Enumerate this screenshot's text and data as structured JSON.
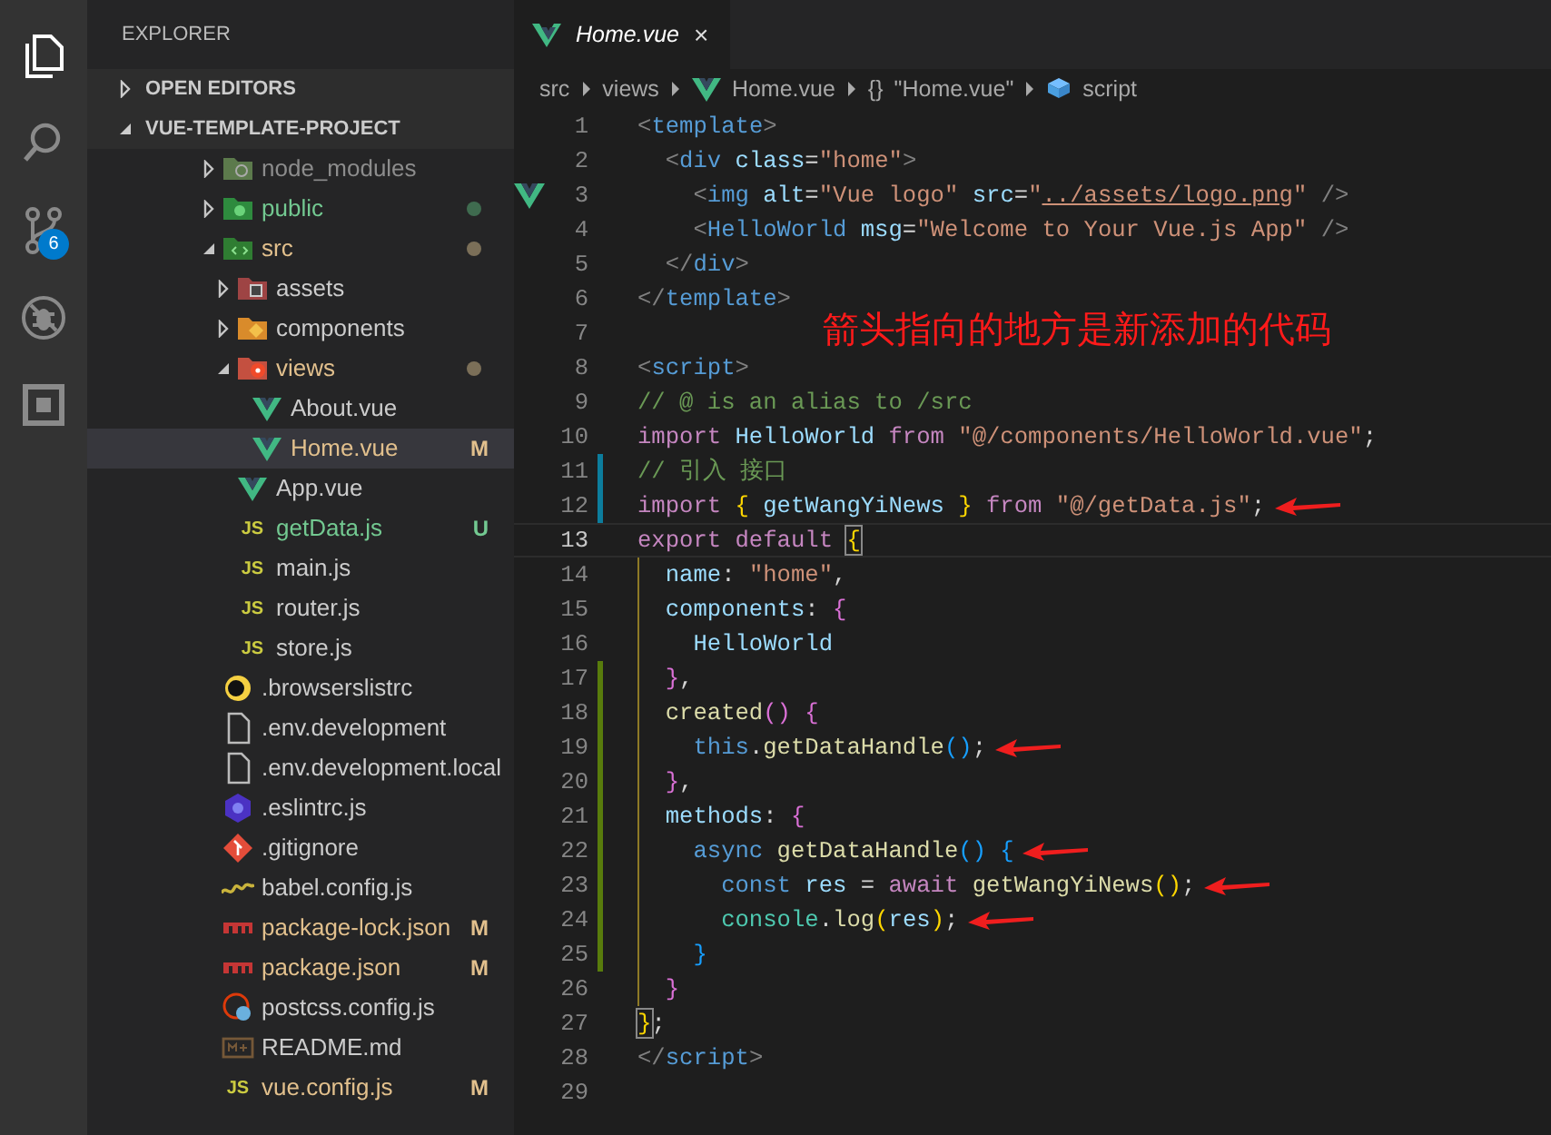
{
  "activity_bar": [
    {
      "kind": "files",
      "selected": true
    },
    {
      "kind": "search",
      "selected": false
    },
    {
      "kind": "source-control",
      "selected": false,
      "badge": "6"
    },
    {
      "kind": "debug",
      "selected": false
    },
    {
      "kind": "extensions",
      "selected": false
    }
  ],
  "sidebar": {
    "title": "EXPLORER",
    "sections": [
      {
        "label": "OPEN EDITORS",
        "expanded": false
      },
      {
        "label": "VUE-TEMPLATE-PROJECT",
        "expanded": true
      }
    ],
    "tree": [
      {
        "label": "node_modules",
        "kind": "node-folder",
        "expanded": false,
        "selected": false,
        "ignored": true
      },
      {
        "label": "public",
        "kind": "public-folder",
        "expanded": false,
        "selected": false,
        "untracked": true,
        "dot": true
      },
      {
        "label": "src",
        "kind": "src-folder",
        "expanded": true,
        "selected": false,
        "modified": true,
        "dot": true,
        "children": [
          {
            "label": "assets",
            "kind": "assets-folder",
            "expanded": false,
            "selected": false
          },
          {
            "label": "components",
            "kind": "components-folder",
            "expanded": false,
            "selected": false
          },
          {
            "label": "views",
            "kind": "views-folder",
            "expanded": true,
            "selected": false,
            "modified": true,
            "dot": true,
            "children": [
              {
                "label": "About.vue",
                "kind": "vue",
                "selected": false
              },
              {
                "label": "Home.vue",
                "kind": "vue",
                "selected": true,
                "modified": true,
                "badge": "M"
              }
            ]
          },
          {
            "label": "App.vue",
            "kind": "vue",
            "selected": false
          },
          {
            "label": "getData.js",
            "kind": "js",
            "icon_text": "JS",
            "selected": false,
            "untracked": true,
            "badge": "U"
          },
          {
            "label": "main.js",
            "kind": "js",
            "icon_text": "JS",
            "selected": false
          },
          {
            "label": "router.js",
            "kind": "js",
            "icon_text": "JS",
            "selected": false
          },
          {
            "label": "store.js",
            "kind": "js",
            "icon_text": "JS",
            "selected": false
          }
        ]
      },
      {
        "label": ".browserslistrc",
        "kind": "browserslist",
        "selected": false
      },
      {
        "label": ".env.development",
        "kind": "file",
        "selected": false
      },
      {
        "label": ".env.development.local",
        "kind": "file",
        "selected": false
      },
      {
        "label": ".eslintrc.js",
        "kind": "eslint",
        "selected": false
      },
      {
        "label": ".gitignore",
        "kind": "git",
        "selected": false
      },
      {
        "label": "babel.config.js",
        "kind": "babel",
        "selected": false
      },
      {
        "label": "package-lock.json",
        "kind": "npm",
        "selected": false,
        "modified": true,
        "badge": "M"
      },
      {
        "label": "package.json",
        "kind": "npm",
        "selected": false,
        "modified": true,
        "badge": "M"
      },
      {
        "label": "postcss.config.js",
        "kind": "postcss",
        "selected": false
      },
      {
        "label": "README.md",
        "kind": "markdown",
        "selected": false
      },
      {
        "label": "vue.config.js",
        "kind": "js",
        "icon_text": "JS",
        "selected": false,
        "modified": true,
        "badge": "M"
      }
    ]
  },
  "tabs": [
    {
      "label": "Home.vue",
      "close": "×",
      "preview": true,
      "selected": true
    }
  ],
  "breadcrumbs": [
    {
      "label": "src",
      "kind": "folder"
    },
    {
      "label": "views",
      "kind": "folder"
    },
    {
      "label": "Home.vue",
      "kind": "vue"
    },
    {
      "label": "\"Home.vue\"",
      "kind": "object",
      "icon_text": "{}"
    },
    {
      "label": "script",
      "kind": "module"
    }
  ],
  "annotation": "箭头指向的地方是新添加的代码",
  "lines": [
    {
      "number": "1",
      "tokens": [
        {
          "text": "<",
          "kind": "punct"
        },
        {
          "text": "template",
          "kind": "tag"
        },
        {
          "text": ">",
          "kind": "punct"
        }
      ]
    },
    {
      "number": "2",
      "tokens": [
        {
          "text": "  <",
          "kind": "punct"
        },
        {
          "text": "div",
          "kind": "tag"
        },
        {
          "text": " class",
          "kind": "attr"
        },
        {
          "text": "=",
          "kind": "plain"
        },
        {
          "text": "\"home\"",
          "kind": "string"
        },
        {
          "text": ">",
          "kind": "punct"
        }
      ]
    },
    {
      "number": "3",
      "glyph": true,
      "tokens": [
        {
          "text": "    <",
          "kind": "punct"
        },
        {
          "text": "img",
          "kind": "tag"
        },
        {
          "text": " alt",
          "kind": "attr"
        },
        {
          "text": "=",
          "kind": "plain"
        },
        {
          "text": "\"Vue logo\"",
          "kind": "string"
        },
        {
          "text": " src",
          "kind": "attr"
        },
        {
          "text": "=",
          "kind": "plain"
        },
        {
          "text": "\"",
          "kind": "string"
        },
        {
          "text": "../assets/logo.png",
          "kind": "link"
        },
        {
          "text": "\"",
          "kind": "string"
        },
        {
          "text": " />",
          "kind": "punct"
        }
      ]
    },
    {
      "number": "4",
      "tokens": [
        {
          "text": "    <",
          "kind": "punct"
        },
        {
          "text": "HelloWorld",
          "kind": "tag"
        },
        {
          "text": " msg",
          "kind": "attr"
        },
        {
          "text": "=",
          "kind": "plain"
        },
        {
          "text": "\"Welcome to Your Vue.js App\"",
          "kind": "string"
        },
        {
          "text": " />",
          "kind": "punct"
        }
      ]
    },
    {
      "number": "5",
      "tokens": [
        {
          "text": "  </",
          "kind": "punct"
        },
        {
          "text": "div",
          "kind": "tag"
        },
        {
          "text": ">",
          "kind": "punct"
        }
      ]
    },
    {
      "number": "6",
      "tokens": [
        {
          "text": "</",
          "kind": "punct"
        },
        {
          "text": "template",
          "kind": "tag"
        },
        {
          "text": ">",
          "kind": "punct"
        }
      ]
    },
    {
      "number": "7"
    },
    {
      "number": "8",
      "tokens": [
        {
          "text": "<",
          "kind": "punct"
        },
        {
          "text": "script",
          "kind": "tag"
        },
        {
          "text": ">",
          "kind": "punct"
        }
      ]
    },
    {
      "number": "9",
      "tokens": [
        {
          "text": "// @ is an alias to /src",
          "kind": "comment"
        }
      ]
    },
    {
      "number": "10",
      "tokens": [
        {
          "text": "import",
          "kind": "keyword"
        },
        {
          "text": " HelloWorld",
          "kind": "variable"
        },
        {
          "text": " from",
          "kind": "keyword"
        },
        {
          "text": " \"@/components/HelloWorld.vue\"",
          "kind": "string"
        },
        {
          "text": ";",
          "kind": "plain"
        }
      ]
    },
    {
      "number": "11",
      "modified": true,
      "tokens": [
        {
          "text": "// 引入 接口",
          "kind": "comment"
        }
      ]
    },
    {
      "number": "12",
      "modified": true,
      "arrow": true,
      "tokens": [
        {
          "text": "import",
          "kind": "keyword"
        },
        {
          "text": " {",
          "kind": "brace1"
        },
        {
          "text": " getWangYiNews",
          "kind": "variable"
        },
        {
          "text": " }",
          "kind": "brace1"
        },
        {
          "text": " from",
          "kind": "keyword"
        },
        {
          "text": " \"@/getData.js\"",
          "kind": "string"
        },
        {
          "text": ";",
          "kind": "plain"
        }
      ]
    },
    {
      "number": "13",
      "current": true,
      "tokens": [
        {
          "text": "export default ",
          "kind": "keyword"
        },
        {
          "text": "{",
          "kind": "match"
        }
      ]
    },
    {
      "number": "14",
      "scope_guide": true,
      "tokens": [
        {
          "text": "  name",
          "kind": "variable"
        },
        {
          "text": ": ",
          "kind": "plain"
        },
        {
          "text": "\"home\"",
          "kind": "string"
        },
        {
          "text": ",",
          "kind": "plain"
        }
      ]
    },
    {
      "number": "15",
      "scope_guide": true,
      "tokens": [
        {
          "text": "  components",
          "kind": "variable"
        },
        {
          "text": ": ",
          "kind": "plain"
        },
        {
          "text": "{",
          "kind": "brace2"
        }
      ]
    },
    {
      "number": "16",
      "scope_guide": true,
      "tokens": [
        {
          "text": "    HelloWorld",
          "kind": "variable"
        }
      ]
    },
    {
      "number": "17",
      "scope_guide": true,
      "added": true,
      "tokens": [
        {
          "text": "  }",
          "kind": "brace2"
        },
        {
          "text": ",",
          "kind": "plain"
        }
      ]
    },
    {
      "number": "18",
      "scope_guide": true,
      "added": true,
      "tokens": [
        {
          "text": "  created",
          "kind": "function"
        },
        {
          "text": "()",
          "kind": "brace2"
        },
        {
          "text": " {",
          "kind": "brace2"
        }
      ]
    },
    {
      "number": "19",
      "scope_guide": true,
      "added": true,
      "arrow": true,
      "tokens": [
        {
          "text": "    this",
          "kind": "storage"
        },
        {
          "text": ".",
          "kind": "plain"
        },
        {
          "text": "getDataHandle",
          "kind": "function"
        },
        {
          "text": "()",
          "kind": "brace3"
        },
        {
          "text": ";",
          "kind": "plain"
        }
      ]
    },
    {
      "number": "20",
      "scope_guide": true,
      "added": true,
      "tokens": [
        {
          "text": "  }",
          "kind": "brace2"
        },
        {
          "text": ",",
          "kind": "plain"
        }
      ]
    },
    {
      "number": "21",
      "scope_guide": true,
      "added": true,
      "tokens": [
        {
          "text": "  methods",
          "kind": "variable"
        },
        {
          "text": ": ",
          "kind": "plain"
        },
        {
          "text": "{",
          "kind": "brace2"
        }
      ]
    },
    {
      "number": "22",
      "scope_guide": true,
      "added": true,
      "arrow": true,
      "tokens": [
        {
          "text": "    async",
          "kind": "storage"
        },
        {
          "text": " getDataHandle",
          "kind": "function"
        },
        {
          "text": "()",
          "kind": "brace3"
        },
        {
          "text": " {",
          "kind": "brace3"
        }
      ]
    },
    {
      "number": "23",
      "scope_guide": true,
      "added": true,
      "arrow": true,
      "tokens": [
        {
          "text": "      const",
          "kind": "storage"
        },
        {
          "text": " res",
          "kind": "variable"
        },
        {
          "text": " = ",
          "kind": "plain"
        },
        {
          "text": "await",
          "kind": "keyword"
        },
        {
          "text": " getWangYiNews",
          "kind": "function"
        },
        {
          "text": "()",
          "kind": "brace1"
        },
        {
          "text": ";",
          "kind": "plain"
        }
      ]
    },
    {
      "number": "24",
      "scope_guide": true,
      "added": true,
      "arrow": true,
      "tokens": [
        {
          "text": "      console",
          "kind": "class"
        },
        {
          "text": ".",
          "kind": "plain"
        },
        {
          "text": "log",
          "kind": "function"
        },
        {
          "text": "(",
          "kind": "brace1"
        },
        {
          "text": "res",
          "kind": "variable"
        },
        {
          "text": ")",
          "kind": "brace1"
        },
        {
          "text": ";",
          "kind": "plain"
        }
      ]
    },
    {
      "number": "25",
      "scope_guide": true,
      "added": true,
      "tokens": [
        {
          "text": "    }",
          "kind": "brace3"
        }
      ]
    },
    {
      "number": "26",
      "scope_guide": true,
      "tokens": [
        {
          "text": "  }",
          "kind": "brace2"
        }
      ]
    },
    {
      "number": "27",
      "tokens": [
        {
          "text": "}",
          "kind": "match"
        },
        {
          "text": ";",
          "kind": "plain"
        }
      ]
    },
    {
      "number": "28",
      "tokens": [
        {
          "text": "</",
          "kind": "punct"
        },
        {
          "text": "script",
          "kind": "tag"
        },
        {
          "text": ">",
          "kind": "punct"
        }
      ]
    },
    {
      "number": "29"
    }
  ]
}
